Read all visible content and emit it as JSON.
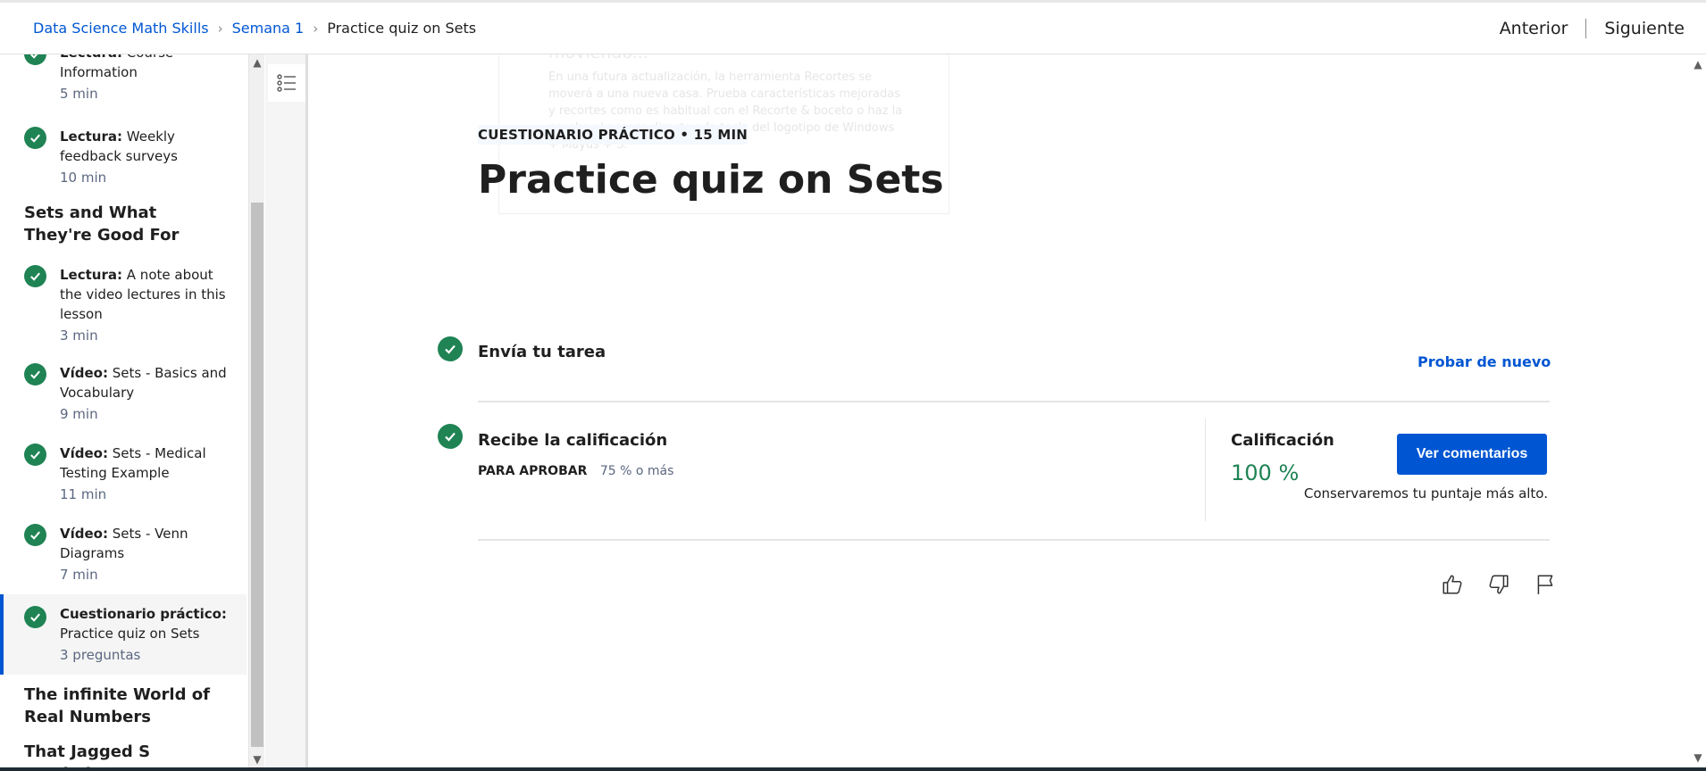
{
  "breadcrumb": {
    "course": "Data Science Math Skills",
    "week": "Semana 1",
    "current": "Practice quiz on Sets",
    "separator": "›"
  },
  "nav": {
    "prev": "Anterior",
    "next": "Siguiente"
  },
  "sidebar": {
    "items": [
      {
        "type": "Lectura:",
        "title": "Course Information",
        "meta": "5 min"
      },
      {
        "type": "Lectura:",
        "title": "Weekly feedback surveys",
        "meta": "10 min"
      },
      {
        "type": "Lectura:",
        "title": "A note about the video lectures in this lesson",
        "meta": "3 min"
      },
      {
        "type": "Vídeo:",
        "title": "Sets - Basics and Vocabulary",
        "meta": "9 min"
      },
      {
        "type": "Vídeo:",
        "title": "Sets - Medical Testing Example",
        "meta": "11 min"
      },
      {
        "type": "Vídeo:",
        "title": "Sets - Venn Diagrams",
        "meta": "7 min"
      },
      {
        "type": "Cuestionario práctico:",
        "title": "Practice quiz on Sets",
        "meta": "3 preguntas"
      }
    ],
    "sections": [
      "Sets and What They're Good For",
      "The infinite World of Real Numbers",
      "That Jagged S Symbol"
    ]
  },
  "toast": {
    "title": "La herramienta Recortes se está moviendo...",
    "body": "En una futura actualización, la herramienta Recortes se moverá a una nueva casa. Prueba características mejoradas y recortes como es habitual con el Recorte & boceto o haz la prueba el acceso directo a la tecla del logotipo de Windows + Mayús + S."
  },
  "main": {
    "eyebrow": "CUESTIONARIO PRÁCTICO • 15 MIN",
    "title": "Practice quiz on Sets",
    "step1_title": "Envía tu tarea",
    "retry": "Probar de nuevo",
    "step2_title": "Recibe la calificación",
    "pass_label": "PARA APROBAR",
    "pass_value": "75 % o más",
    "grade_label": "Calificación",
    "grade_value": "100 %",
    "view_feedback": "Ver comentarios",
    "keep_note": "Conservaremos tu puntaje más alto."
  },
  "colors": {
    "accent": "#0056d2",
    "success": "#1f8354"
  }
}
